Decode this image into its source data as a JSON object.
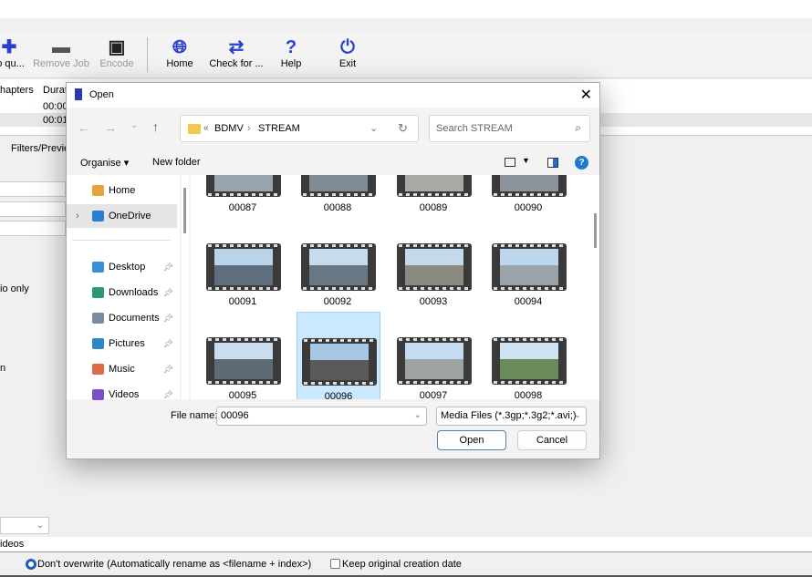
{
  "app": {
    "toolbar": [
      {
        "label": "to qu...",
        "icon": "plus-icon",
        "enabled": true
      },
      {
        "label": "Remove Job",
        "icon": "minus-icon",
        "enabled": false
      },
      {
        "label": "Encode",
        "icon": "film-encode-icon",
        "enabled": false
      },
      {
        "label": "Home",
        "icon": "globe-icon",
        "enabled": true
      },
      {
        "label": "Check for ...",
        "icon": "refresh-icon",
        "enabled": true
      },
      {
        "label": "Help",
        "icon": "question-icon",
        "enabled": true
      },
      {
        "label": "Exit",
        "icon": "power-icon",
        "enabled": true
      }
    ],
    "columns": [
      "hapters",
      "Durat"
    ],
    "rows": [
      "00:00",
      "00:01"
    ],
    "tab": "Filters/Preview",
    "audio_only": "io only",
    "partial_n": "n",
    "videos_label": "ideos",
    "overwrite_option": "Don't overwrite (Automatically rename as <filename + index>)",
    "keep_date_label": "Keep original creation date"
  },
  "dialog": {
    "title": "Open",
    "breadcrumb": [
      "«",
      "BDMV",
      "STREAM"
    ],
    "search_placeholder": "Search STREAM",
    "organise": "Organise ▾",
    "new_folder": "New folder",
    "sidebar": [
      {
        "label": "Home",
        "icon": "home-icon",
        "color": "#e8a33c"
      },
      {
        "label": "OneDrive",
        "icon": "cloud-icon",
        "color": "#2a7fd4",
        "selected": true
      },
      {
        "label": "Desktop",
        "icon": "desktop-icon",
        "color": "#3b8fd9",
        "pinned": true
      },
      {
        "label": "Downloads",
        "icon": "download-icon",
        "color": "#2b9a6e",
        "pinned": true
      },
      {
        "label": "Documents",
        "icon": "documents-icon",
        "color": "#7a8aa0",
        "pinned": true
      },
      {
        "label": "Pictures",
        "icon": "pictures-icon",
        "color": "#2d86c8",
        "pinned": true
      },
      {
        "label": "Music",
        "icon": "music-icon",
        "color": "#e0694a",
        "pinned": true
      },
      {
        "label": "Videos",
        "icon": "videos-icon",
        "color": "#7b4fc9",
        "pinned": true
      }
    ],
    "files": [
      "00087",
      "00088",
      "00089",
      "00090",
      "00091",
      "00092",
      "00093",
      "00094",
      "00095",
      "00096",
      "00097",
      "00098"
    ],
    "selected_file": "00096",
    "file_name_label": "File name:",
    "file_name_value": "00096",
    "file_type": "Media Files (*.3gp;*.3g2;*.avi;)",
    "open_label": "Open",
    "cancel_label": "Cancel"
  }
}
